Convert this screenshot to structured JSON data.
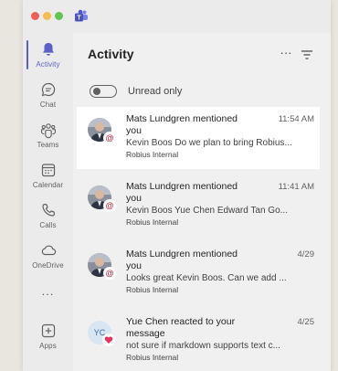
{
  "rail": {
    "items": [
      {
        "label": "Activity",
        "icon": "bell-icon"
      },
      {
        "label": "Chat",
        "icon": "chat-icon"
      },
      {
        "label": "Teams",
        "icon": "teams-icon"
      },
      {
        "label": "Calendar",
        "icon": "calendar-icon"
      },
      {
        "label": "Calls",
        "icon": "phone-icon"
      },
      {
        "label": "OneDrive",
        "icon": "cloud-icon"
      },
      {
        "label": "Apps",
        "icon": "apps-icon"
      }
    ],
    "more": "..."
  },
  "header": {
    "title": "Activity",
    "more": "···"
  },
  "unread": {
    "label": "Unread only"
  },
  "activities": [
    {
      "title": "Mats Lundgren mentioned",
      "title2": "you",
      "time": "11:54 AM",
      "preview": "Kevin Boos Do we plan to bring Robius...",
      "channel": "Robius Internal"
    },
    {
      "title": "Mats Lundgren mentioned",
      "title2": "you",
      "time": "11:41 AM",
      "preview": "Kevin Boos Yue Chen Edward Tan Go...",
      "channel": "Robius Internal"
    },
    {
      "title": "Mats Lundgren mentioned",
      "title2": "you",
      "time": "4/29",
      "preview": "Looks great Kevin Boos. Can we add ...",
      "channel": "Robius Internal"
    },
    {
      "title": "Yue Chen reacted to your",
      "title2": "message",
      "time": "4/25",
      "preview": "not sure if markdown supports text c...",
      "channel": "Robius Internal",
      "initials": "YC"
    }
  ],
  "colors": {
    "accent": "#5b5fc7",
    "mention": "#c4314b"
  }
}
